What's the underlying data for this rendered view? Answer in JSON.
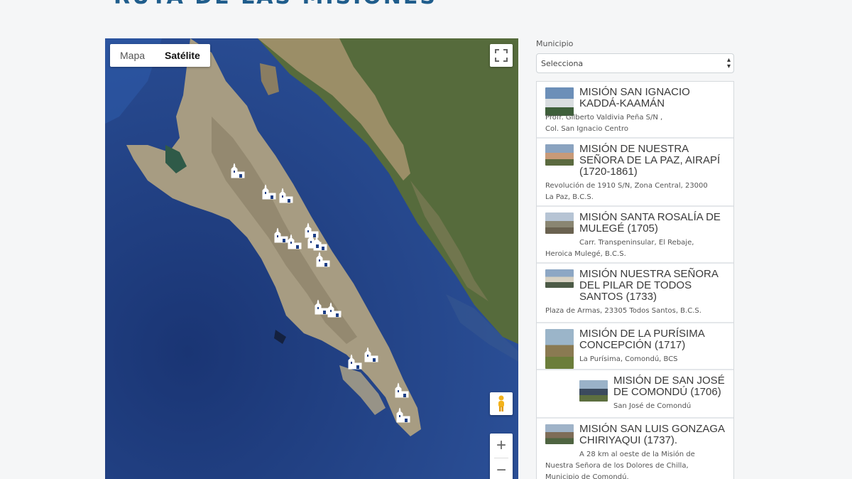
{
  "page": {
    "title": "RUTA DE LAS MISIONES"
  },
  "map": {
    "type_options": [
      "Mapa",
      "Satélite"
    ],
    "active_type": "Satélite",
    "zoom_in": "+",
    "zoom_out": "−",
    "marker_icon": "mission-church-icon"
  },
  "filter": {
    "label": "Municipio",
    "select_value": "Selecciona"
  },
  "missions": [
    {
      "title_lines": [
        "MISIÓN SAN IGNACIO",
        "KADDÁ-KAAMÁN"
      ],
      "address_lines": [
        "Profr. Gilberto Valdivia Peña S/N ,",
        "Col. San Ignacio Centro"
      ]
    },
    {
      "title_lines": [
        "MISIÓN DE NUESTRA",
        "SEÑORA DE LA PAZ, AIRAPÍ",
        "(1720-1861)"
      ],
      "address_lines": [
        "Revolución de 1910 S/N, Zona Central, 23000",
        "La Paz, B.C.S."
      ]
    },
    {
      "title_lines": [
        "MISIÓN SANTA ROSALÍA DE",
        "MULEGÉ (1705)"
      ],
      "address_lines": [
        "Carr. Transpeninsular, El Rebaje,",
        "Heroica Mulegé, B.C.S."
      ]
    },
    {
      "title_lines": [
        "MISIÓN NUESTRA SEÑORA",
        "DEL PILAR DE TODOS",
        "SANTOS (1733)"
      ],
      "address_lines": [
        "Plaza de Armas, 23305 Todos Santos, B.C.S."
      ]
    },
    {
      "title_lines": [
        "MISIÓN DE LA PURÍSIMA",
        "CONCEPCIÓN (1717)"
      ],
      "address_lines": [
        "La Purísima, Comondú, BCS"
      ]
    },
    {
      "title_lines": [
        "MISIÓN DE SAN JOSÉ",
        "DE COMONDÚ (1706)"
      ],
      "address_lines": [
        "San José de Comondú"
      ]
    },
    {
      "title_lines": [
        "MISIÓN SAN LUIS GONZAGA",
        "CHIRIYAQUI (1737)."
      ],
      "address_lines": [
        "A 28 km al oeste de la Misión de",
        "Nuestra Señora de los Dolores de Chilla,",
        "Municipio de Comondú."
      ]
    }
  ],
  "colors": {
    "ocean": "#1e3f86",
    "land": "#a79c82",
    "mainland_green": "#566b3c",
    "title": "#1f5d8c"
  }
}
